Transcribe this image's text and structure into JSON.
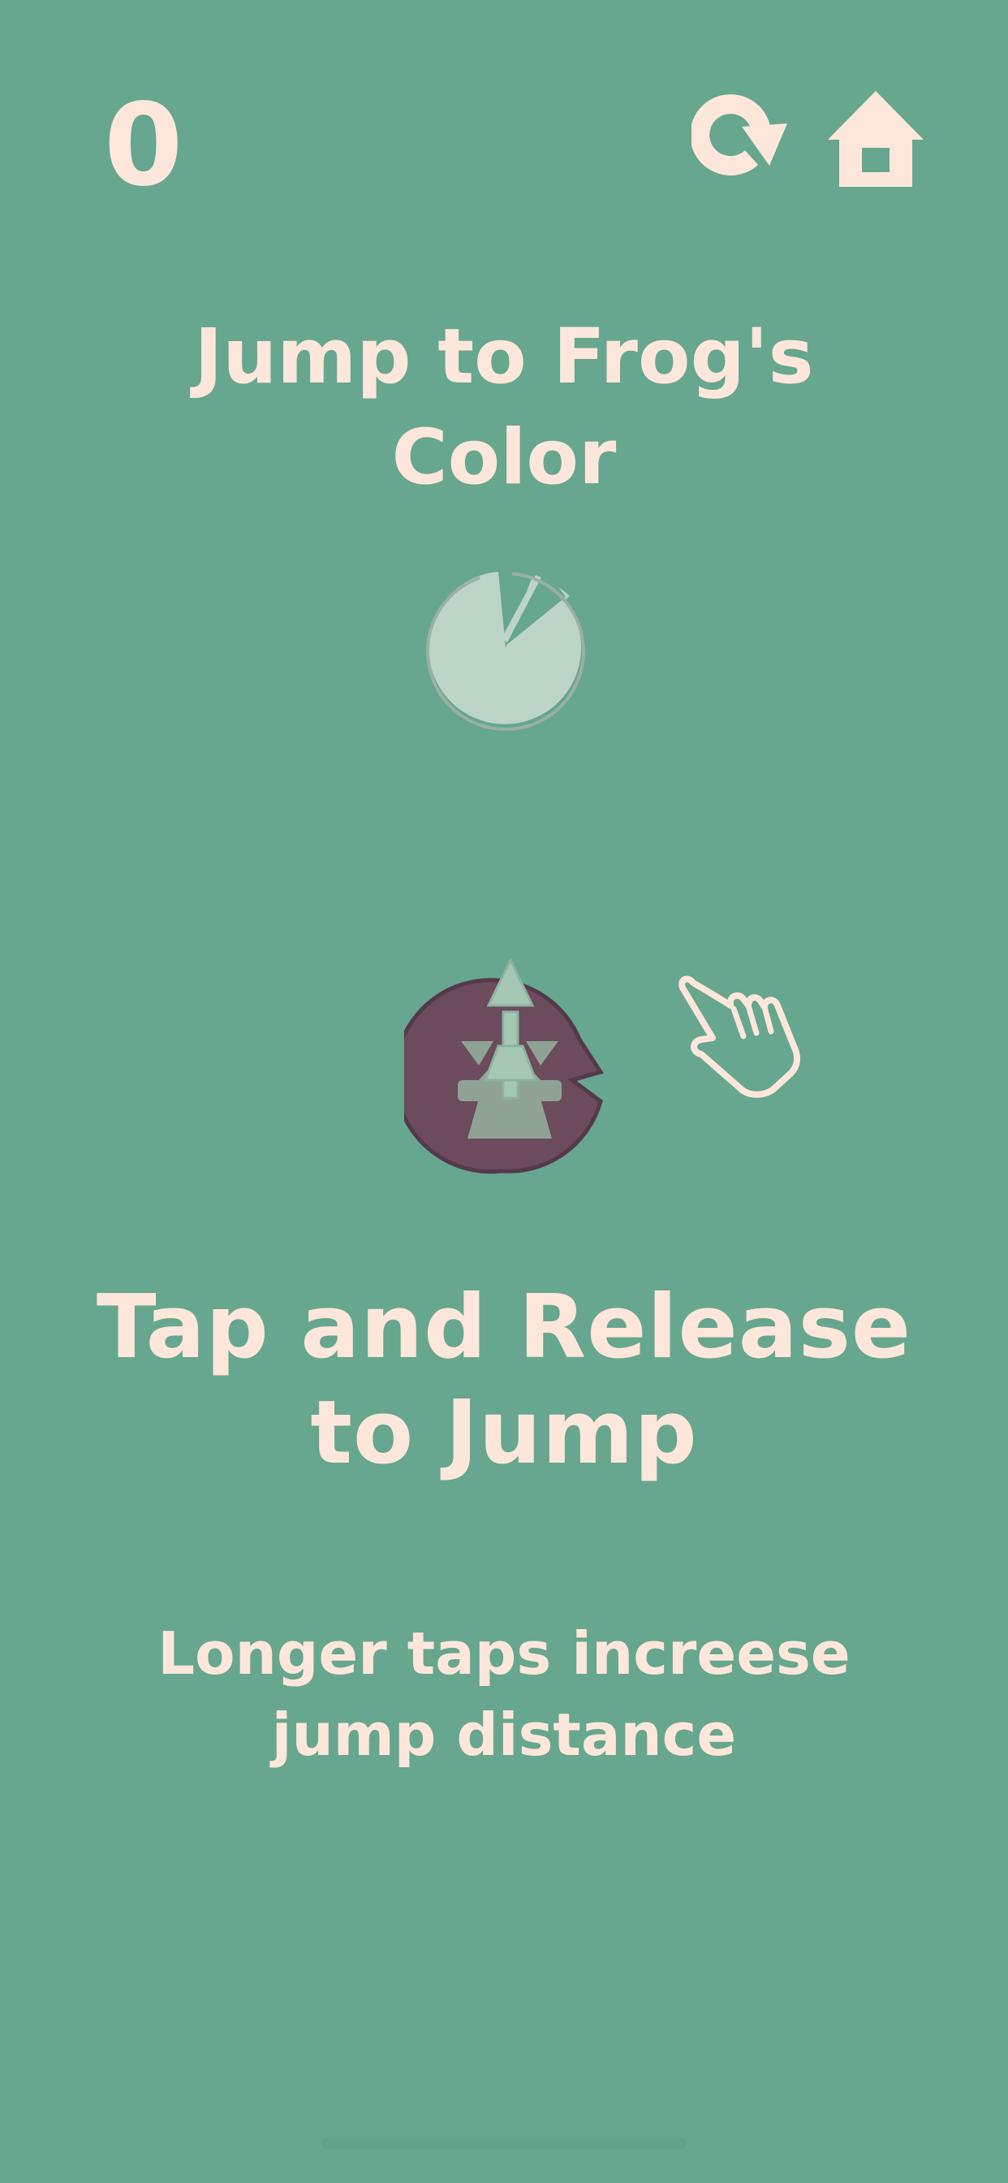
{
  "hud": {
    "score": "0",
    "restart_icon": "restart-icon",
    "home_icon": "home-icon"
  },
  "title": {
    "line1": "Jump to Frog's",
    "line2": "Color"
  },
  "instruction": {
    "line1": "Tap and Release",
    "line2": "to Jump"
  },
  "hint": {
    "line1": "Longer taps increese",
    "line2": "jump distance"
  },
  "colors": {
    "background": "#67a68f",
    "text": "#fde7da",
    "target_pad": "#bcd5c7",
    "player_pad": "#6b4b5c",
    "frog": "#8fa394",
    "arrow": "#a7c7b5"
  },
  "icons": {
    "target": "lily-pad-icon",
    "player_pad": "lily-pad-icon",
    "frog": "frog-icon",
    "arrow": "jump-arrow-icon",
    "hand": "tap-hand-icon"
  }
}
